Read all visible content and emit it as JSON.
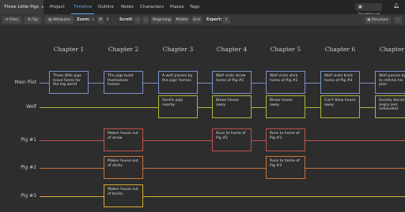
{
  "header": {
    "project_title": "Three Little Pigs",
    "tabs": [
      "Project",
      "Timeline",
      "Outline",
      "Notes",
      "Characters",
      "Places",
      "Tags"
    ],
    "dashboard_label": "Dashboard"
  },
  "toolbar": {
    "filter": "Filter",
    "flip": "Flip",
    "attributes": "Attributes",
    "zoom_label": "Zoom:",
    "zoom_l": "L",
    "zoom_m": "M",
    "zoom_s": "S",
    "scroll_label": "Scroll:",
    "scroll_prev": "‹",
    "scroll_next": "›",
    "beginning": "Beginning",
    "middle": "Middle",
    "end": "End",
    "export_label": "Export:",
    "structure": "Structure"
  },
  "timeline": {
    "chapters": [
      "Chapter 1",
      "Chapter 2",
      "Chapter 3",
      "Chapter 4",
      "Chapter 5",
      "Chapter 6",
      "Chapter 7"
    ],
    "rows": [
      {
        "label": "Main Plot",
        "color": "#7c93c9",
        "cards": [
          {
            "ch": 0,
            "text": "Three little pigs leave home for the big world"
          },
          {
            "ch": 1,
            "text": "The pigs build themselves homes"
          },
          {
            "ch": 2,
            "text": "A wolf passes by the pigs' homes"
          },
          {
            "ch": 3,
            "text": "Wolf visits straw home of Pig #1"
          },
          {
            "ch": 4,
            "text": "Wolf visits stick home of Pig #2"
          },
          {
            "ch": 5,
            "text": "Wolf visits brick home of Pig #3"
          },
          {
            "ch": 6,
            "text": "Wolf passes by to rethink his plan"
          }
        ]
      },
      {
        "label": "Wolf",
        "color": "#b1b43b",
        "cards": [
          {
            "ch": 2,
            "text": "Smells pigs nearby"
          },
          {
            "ch": 3,
            "text": "Blows house away"
          },
          {
            "ch": 4,
            "text": "Blows house away"
          },
          {
            "ch": 5,
            "text": "Can't blow house away"
          },
          {
            "ch": 6,
            "text": "Quickly becomes angry and exhausted"
          }
        ]
      },
      {
        "label": "Pig #1",
        "color": "#c4534d",
        "cards": [
          {
            "ch": 1,
            "text": "Makes house out of straw"
          },
          {
            "ch": 3,
            "text": "Runs to home of Pig #2"
          },
          {
            "ch": 4,
            "text": "Runs to home of Pig #3"
          }
        ]
      },
      {
        "label": "Pig #2",
        "color": "#c9763c",
        "cards": [
          {
            "ch": 1,
            "text": "Makes house out of sticks"
          },
          {
            "ch": 4,
            "text": "Runs to home of Pig #3"
          }
        ]
      },
      {
        "label": "Pig #3",
        "color": "#d9aa32",
        "cards": [
          {
            "ch": 1,
            "text": "Makes house out of bricks"
          }
        ]
      }
    ]
  }
}
